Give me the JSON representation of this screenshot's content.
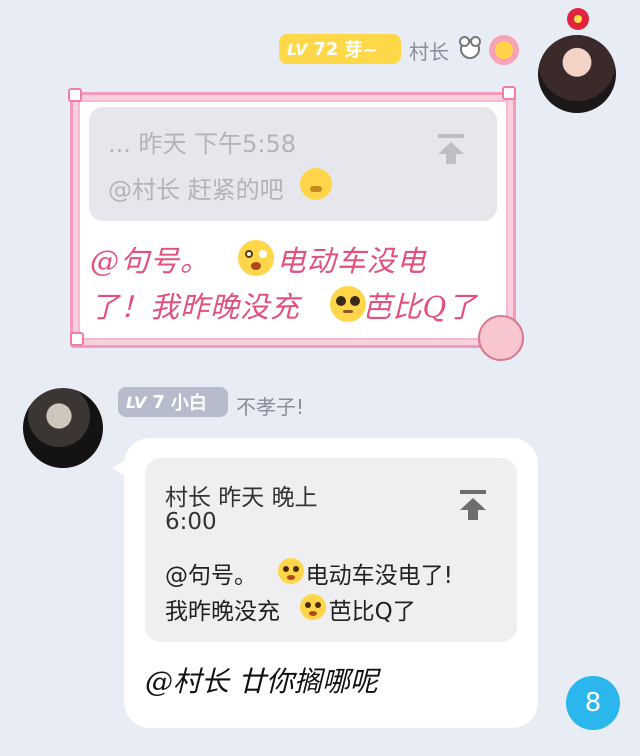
{
  "message_right": {
    "level_label": "LV",
    "level_number": "72",
    "badge_title": "芽~",
    "sender_name": "村长",
    "quote": {
      "line1": "... 昨天 下午5:58",
      "line2": "@村长 赶紧的吧"
    },
    "text_line1": "@句号。",
    "text_line1b": "电动车没电",
    "text_line2a": "了！我昨晚没充",
    "text_line2b": "芭比Q了"
  },
  "message_left": {
    "level_label": "LV",
    "level_number": "7",
    "badge_title": "小白",
    "sender_name": "不孝子!",
    "quote": {
      "line1": "村长 昨天 晚上",
      "line2": "6:00",
      "line3a": "@句号。",
      "line3b": "电动车没电了!",
      "line4a": "我昨晚没充",
      "line4b": "芭比Q了"
    },
    "reply_text": "@村长  廿你搁哪呢"
  },
  "unread_count": "8",
  "colors": {
    "background": "#e8ecf5",
    "level_badge_high": "#ffd84a",
    "level_badge_low": "#b6bccc",
    "frame_pink": "#f29aba",
    "handwriting_pink": "#e3507c",
    "unread_badge": "#2bb6ee"
  },
  "icons": [
    "bear-icon",
    "flower-icon",
    "pin-top-icon",
    "thinking-emoji-icon",
    "shocked-emoji-icon",
    "pleading-emoji-icon"
  ]
}
